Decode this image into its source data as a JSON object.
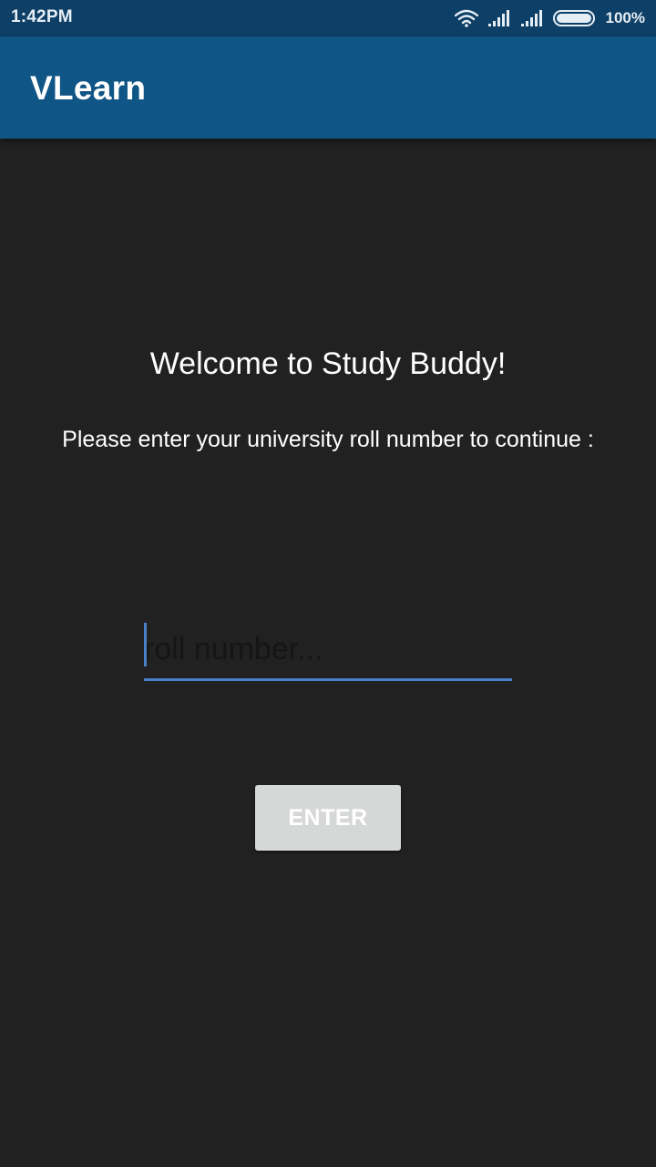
{
  "status_bar": {
    "time": "1:42PM",
    "battery_percent": "100%",
    "icons": [
      "wifi-icon",
      "signal-icon",
      "signal-icon",
      "battery-icon"
    ],
    "battery_level": 1.0
  },
  "app_bar": {
    "title": "VLearn"
  },
  "main": {
    "welcome": "Welcome to Study Buddy!",
    "instruction": "Please enter your university roll number to continue :",
    "roll_input": {
      "placeholder": "roll number...",
      "value": ""
    },
    "enter_label": "ENTER"
  },
  "colors": {
    "status_bar": "#0e3f66",
    "app_bar": "#0f5585",
    "background": "#212121",
    "accent": "#4a80c8",
    "button": "#d6d7d7"
  }
}
